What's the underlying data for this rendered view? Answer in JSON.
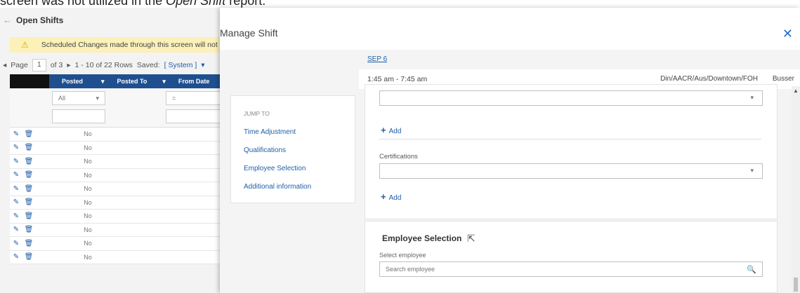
{
  "caption": {
    "text": "screen was not utilized in the ",
    "italic": "Open Shift",
    "after": " report."
  },
  "background": {
    "back_icon": "arrow-left-icon",
    "title": "Open Shifts",
    "warning": "Scheduled Changes made through this screen will not trigge",
    "pager": {
      "label": "Page",
      "page": "1",
      "of": "of 3",
      "rows": "1 - 10 of 22 Rows",
      "saved_label": "Saved:",
      "saved_value": "[ System ]"
    },
    "columns": [
      "Posted",
      "Posted To",
      "From Date"
    ],
    "filter": {
      "posted": "All",
      "from": "="
    },
    "rows": [
      "No",
      "No",
      "No",
      "No",
      "No",
      "No",
      "No",
      "No",
      "No",
      "No"
    ]
  },
  "modal": {
    "title": "Manage Shift",
    "close": "✕",
    "date": "SEP 6",
    "time": "1:45 am - 7:45 am",
    "location": "Din/AACR/Aus/Downtown/FOH",
    "role": "Busser",
    "jump": {
      "title": "JUMP TO",
      "links": [
        "Time Adjustment",
        "Qualifications",
        "Employee Selection",
        "Additional information"
      ]
    },
    "qual": {
      "add1": "Add",
      "cert_label": "Certifications",
      "add2": "Add"
    },
    "employee": {
      "heading": "Employee Selection",
      "label": "Select employee",
      "placeholder": "Search employee"
    }
  }
}
